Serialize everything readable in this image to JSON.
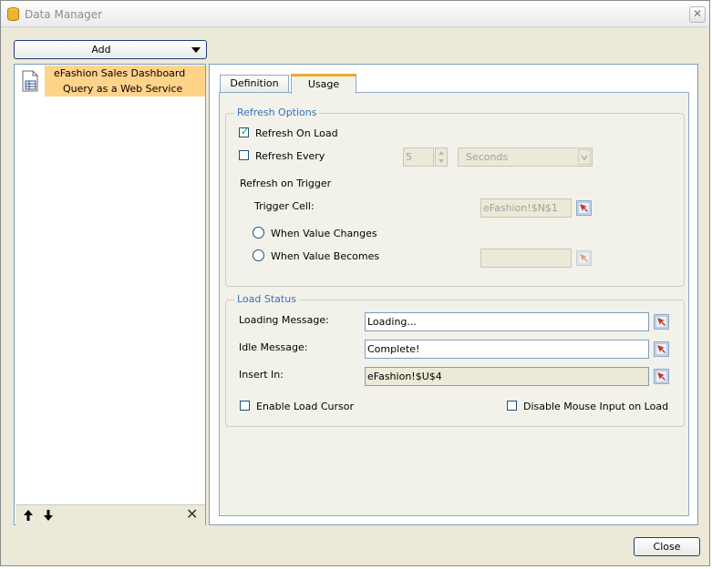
{
  "window": {
    "title": "Data Manager",
    "close_glyph": "✕"
  },
  "toolbar": {
    "add_label": "Add"
  },
  "connections": {
    "items": [
      {
        "line1": "eFashion Sales Dashboard",
        "line2": "Query as a Web Service",
        "icon": "query-document-icon"
      }
    ],
    "move_up_glyph": "🡑",
    "move_down_glyph": "🡓",
    "delete_glyph": "✕"
  },
  "tabs": [
    {
      "label": "Definition",
      "selected": false
    },
    {
      "label": "Usage",
      "selected": true
    }
  ],
  "refresh_options": {
    "legend": "Refresh Options",
    "refresh_on_load": {
      "label": "Refresh On Load",
      "checked": true
    },
    "refresh_every": {
      "label": "Refresh Every",
      "checked": false,
      "value": "5",
      "unit": "Seconds"
    },
    "refresh_on_trigger": "Refresh on Trigger",
    "trigger_cell": {
      "label": "Trigger Cell:",
      "value": "eFashion!$N$1"
    },
    "when_value_changes": {
      "label": "When Value Changes",
      "selected": false
    },
    "when_value_becomes": {
      "label": "When Value Becomes",
      "selected": false,
      "value": ""
    }
  },
  "load_status": {
    "legend": "Load Status",
    "loading_message": {
      "label": "Loading Message:",
      "value": "Loading..."
    },
    "idle_message": {
      "label": "Idle Message:",
      "value": "Complete!"
    },
    "insert_in": {
      "label": "Insert In:",
      "value": "eFashion!$U$4"
    },
    "enable_load_cursor": {
      "label": "Enable Load Cursor",
      "checked": false
    },
    "disable_mouse_input": {
      "label": "Disable Mouse Input on Load",
      "checked": false
    }
  },
  "footer": {
    "close_label": "Close"
  },
  "colors": {
    "selection": "#ffd38a",
    "legend_text": "#3a6fbf",
    "picker_arrow": "#c0392b"
  }
}
